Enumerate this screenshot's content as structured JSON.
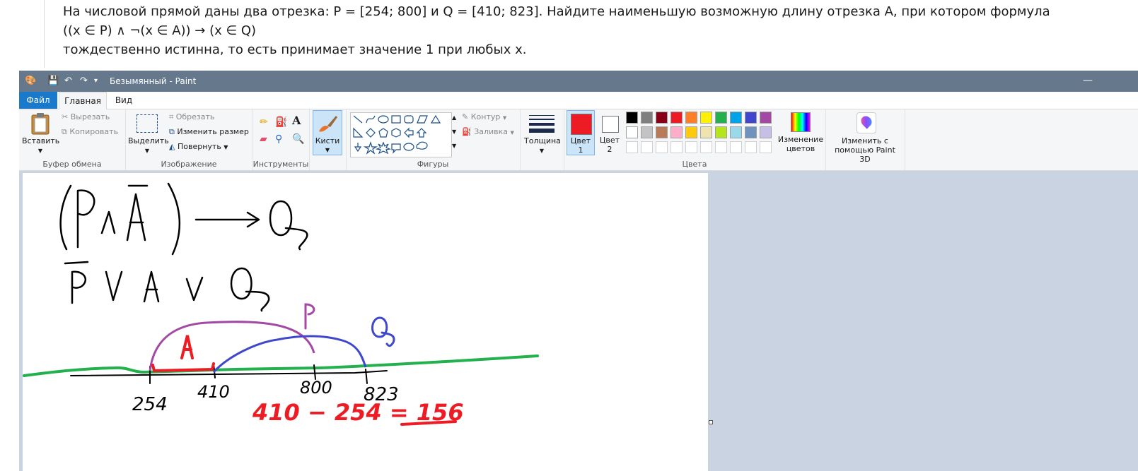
{
  "problem": {
    "line1": "На числовой прямой даны два отрезка: P = [254; 800] и Q = [410; 823]. Найдите наименьшую возможную длину отрезка A, при котором формула",
    "line2": "((x ∈ P) ∧ ¬(x ∈ A)) → (x ∈ Q)",
    "line3": "тождественно истинна, то есть принимает значение 1 при любых x."
  },
  "window": {
    "title": "Безымянный - Paint",
    "minimize": "—"
  },
  "tabs": {
    "file": "Файл",
    "home": "Главная",
    "view": "Вид"
  },
  "clipboard": {
    "paste": "Вставить",
    "cut": "Вырезать",
    "copy": "Копировать",
    "label": "Буфер обмена"
  },
  "image": {
    "select": "Выделить",
    "crop": "Обрезать",
    "resize": "Изменить размер",
    "rotate": "Повернуть",
    "label": "Изображение"
  },
  "tools": {
    "label": "Инструменты"
  },
  "brushes": {
    "label": "Кисти"
  },
  "shapes": {
    "outline": "Контур",
    "fill": "Заливка",
    "label": "Фигуры"
  },
  "size": {
    "label": "Толщина"
  },
  "colors": {
    "color1": "Цвет 1",
    "color2": "Цвет 2",
    "edit": "Изменение цветов",
    "label": "Цвета",
    "color1_value": "#ed1c24",
    "color2_value": "#ffffff",
    "palette_row1": [
      "#000000",
      "#7f7f7f",
      "#880015",
      "#ed1c24",
      "#ff7f27",
      "#fff200",
      "#22b14c",
      "#00a2e8",
      "#3f48cc",
      "#a349a4"
    ],
    "palette_row2": [
      "#ffffff",
      "#c3c3c3",
      "#b97a57",
      "#ffaec9",
      "#ffc90e",
      "#efe4b0",
      "#b5e61d",
      "#99d9ea",
      "#7092be",
      "#c8bfe7"
    ]
  },
  "paint3d": {
    "label": "Изменить с помощью Paint 3D"
  },
  "drawing": {
    "line1": "(P ∧ Ā) → Q",
    "line2": "P̄ ∨ A ∨ Q",
    "label_P": "P",
    "label_Q": "Q",
    "label_A": "A",
    "tick_254": "254",
    "tick_410": "410",
    "tick_800": "800",
    "tick_823": "823",
    "answer": "410 − 254 = 156",
    "colors": {
      "ink": "#000000",
      "P": "#a349a4",
      "Q": "#3f48cc",
      "A": "#ed1c24",
      "axis": "#22b14c"
    }
  }
}
